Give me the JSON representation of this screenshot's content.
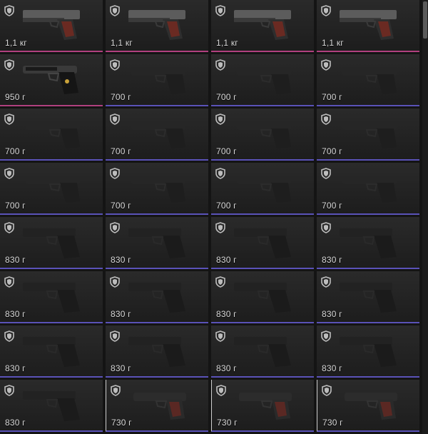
{
  "colors": {
    "rarity_pink": "#b0407e",
    "rarity_purple": "#5a52b8",
    "slot_bg": "#232323"
  },
  "inventory": {
    "icon": "shield-icon",
    "items": [
      {
        "weight": "1,1 кг",
        "model": "colt-pistol-icon",
        "rarity": "pink"
      },
      {
        "weight": "1,1 кг",
        "model": "colt-pistol-icon",
        "rarity": "pink"
      },
      {
        "weight": "1,1 кг",
        "model": "colt-pistol-icon",
        "rarity": "pink"
      },
      {
        "weight": "1,1 кг",
        "model": "colt-pistol-icon",
        "rarity": "pink"
      },
      {
        "weight": "950 г",
        "model": "beretta-pistol-icon",
        "rarity": "pink"
      },
      {
        "weight": "700 г",
        "model": "compact-pistol-icon",
        "rarity": "purple"
      },
      {
        "weight": "700 г",
        "model": "compact-pistol-icon",
        "rarity": "purple"
      },
      {
        "weight": "700 г",
        "model": "compact-pistol-icon",
        "rarity": "purple"
      },
      {
        "weight": "700 г",
        "model": "compact-pistol-icon",
        "rarity": "purple"
      },
      {
        "weight": "700 г",
        "model": "compact-pistol-icon",
        "rarity": "purple"
      },
      {
        "weight": "700 г",
        "model": "compact-pistol-icon",
        "rarity": "purple"
      },
      {
        "weight": "700 г",
        "model": "compact-pistol-icon",
        "rarity": "purple"
      },
      {
        "weight": "700 г",
        "model": "compact-pistol-icon",
        "rarity": "purple"
      },
      {
        "weight": "700 г",
        "model": "compact-pistol-icon",
        "rarity": "purple"
      },
      {
        "weight": "700 г",
        "model": "compact-pistol-icon",
        "rarity": "purple"
      },
      {
        "weight": "700 г",
        "model": "compact-pistol-icon",
        "rarity": "purple"
      },
      {
        "weight": "830 г",
        "model": "sport-pistol-icon",
        "rarity": "purple"
      },
      {
        "weight": "830 г",
        "model": "sport-pistol-icon",
        "rarity": "purple"
      },
      {
        "weight": "830 г",
        "model": "sport-pistol-icon",
        "rarity": "purple"
      },
      {
        "weight": "830 г",
        "model": "sport-pistol-icon",
        "rarity": "purple"
      },
      {
        "weight": "830 г",
        "model": "sport-pistol-icon",
        "rarity": "purple"
      },
      {
        "weight": "830 г",
        "model": "sport-pistol-icon",
        "rarity": "purple"
      },
      {
        "weight": "830 г",
        "model": "sport-pistol-icon",
        "rarity": "purple"
      },
      {
        "weight": "830 г",
        "model": "sport-pistol-icon",
        "rarity": "purple"
      },
      {
        "weight": "830 г",
        "model": "sport-pistol-icon",
        "rarity": "purple"
      },
      {
        "weight": "830 г",
        "model": "sport-pistol-icon",
        "rarity": "purple"
      },
      {
        "weight": "830 г",
        "model": "sport-pistol-icon",
        "rarity": "purple"
      },
      {
        "weight": "830 г",
        "model": "sport-pistol-icon",
        "rarity": "purple"
      },
      {
        "weight": "830 г",
        "model": "sport-pistol-icon",
        "rarity": "purple"
      },
      {
        "weight": "730 г",
        "model": "makarov-pistol-icon",
        "rarity": "purple"
      },
      {
        "weight": "730 г",
        "model": "makarov-pistol-icon",
        "rarity": "purple"
      },
      {
        "weight": "730 г",
        "model": "makarov-pistol-icon",
        "rarity": "purple"
      }
    ]
  }
}
